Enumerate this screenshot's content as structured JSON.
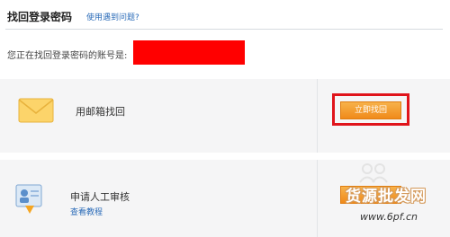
{
  "header": {
    "title": "找回登录密码",
    "help_link": "使用遇到问题?"
  },
  "account": {
    "label": "您正在找回登录密码的账号是:"
  },
  "methods": {
    "email": {
      "label": "用邮箱找回",
      "icon": "envelope-icon",
      "button_label": "立即找回"
    },
    "manual": {
      "label": "申请人工审核",
      "link": "查看教程",
      "icon": "person-card-icon"
    }
  },
  "watermark": {
    "name": "货源批发网",
    "url": "www.6pf.cn"
  },
  "colors": {
    "accent": "#f28c1e",
    "highlight": "#e0141b",
    "link": "#2a6bb8",
    "redaction": "#ff0000"
  }
}
